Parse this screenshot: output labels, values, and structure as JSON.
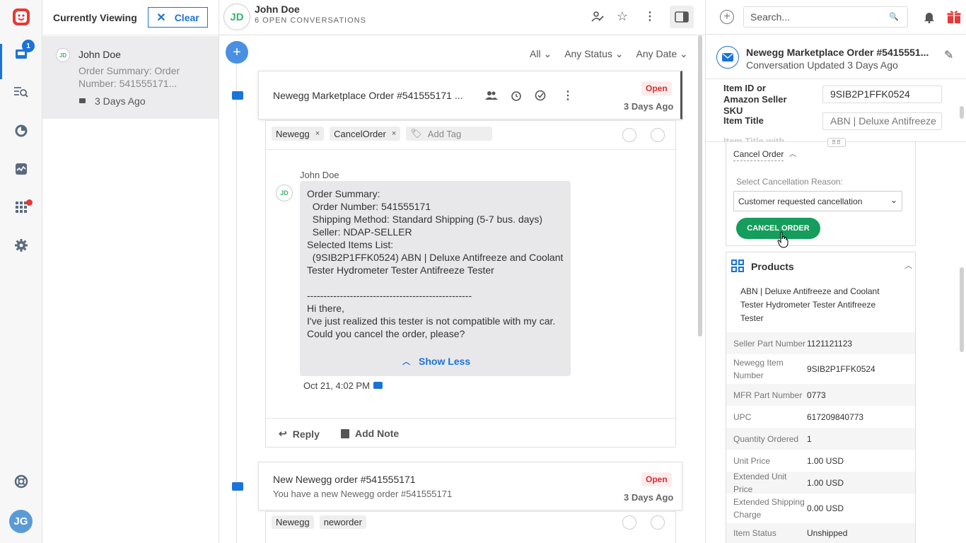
{
  "rail": {
    "inbox_badge": "1",
    "avatar_initials": "JG"
  },
  "list": {
    "header": "Currently Viewing",
    "clear_label": "Clear",
    "item": {
      "initials": "JD",
      "name": "John Doe",
      "preview": "Order Summary:  Order Number: 541555171...",
      "time": "3 Days Ago"
    }
  },
  "conversation": {
    "initials": "JD",
    "name": "John Doe",
    "sub": "6 OPEN CONVERSATIONS",
    "filters": [
      "All",
      "Any Status",
      "Any Date"
    ],
    "card1": {
      "subject": "Newegg Marketplace Order #541555171 ...",
      "status": "Open",
      "time": "3 Days Ago",
      "tags": [
        "Newegg",
        "CancelOrder"
      ],
      "add_tag": "Add Tag",
      "author": "John Doe",
      "author_initials": "JD",
      "body": "Order Summary:\n  Order Number: 541555171\n  Shipping Method: Standard Shipping (5-7 bus. days)\n  Seller: NDAP-SELLER\nSelected Items List:\n  (9SIB2P1FFK0524) ABN | Deluxe Antifreeze and Coolant Tester Hydrometer Tester Antifreeze Tester\n\n--------------------------------------------------\nHi there,\nI've just realized this tester is not compatible with my car. Could you cancel the order, please?",
      "show_less": "Show Less",
      "timestamp": "Oct 21, 4:02 PM",
      "reply": "Reply",
      "add_note": "Add Note"
    },
    "card2": {
      "subject": "New Newegg order #541555171",
      "preview": "You have a new Newegg order #541555171",
      "status": "Open",
      "time": "3 Days Ago",
      "tags": [
        "Newegg",
        "neworder"
      ]
    }
  },
  "right": {
    "search_placeholder": "Search...",
    "title": "Newegg Marketplace Order #5415551...",
    "subtitle": "Conversation Updated 3 Days Ago",
    "fields": [
      {
        "label": "Item ID or Amazon Seller SKU",
        "value": "9SIB2P1FFK0524"
      },
      {
        "label": "Item Title",
        "value": "ABN | Deluxe Antifreeze"
      },
      {
        "label": "Item Title with",
        "value": ""
      }
    ],
    "cancel_section": "Cancel Order",
    "reason_label": "Select Cancellation Reason:",
    "reason_value": "Customer requested cancellation",
    "cancel_button": "CANCEL ORDER",
    "products_title": "Products",
    "product_name": "ABN | Deluxe Antifreeze and Coolant Tester Hydrometer Tester Antifreeze Tester",
    "product_rows": [
      {
        "k": "Seller Part Number",
        "v": "1121121123"
      },
      {
        "k": "Newegg Item Number",
        "v": "9SIB2P1FFK0524"
      },
      {
        "k": "MFR Part Number",
        "v": "0773"
      },
      {
        "k": "UPC",
        "v": "617209840773"
      },
      {
        "k": "Quantity Ordered",
        "v": "1"
      },
      {
        "k": "Unit Price",
        "v": "1.00 USD"
      },
      {
        "k": "Extended Unit Price",
        "v": "1.00 USD"
      },
      {
        "k": "Extended Shipping Charge",
        "v": "0.00 USD"
      },
      {
        "k": "Item Status",
        "v": "Unshipped"
      }
    ],
    "colors": {
      "accent": "#1a73d9",
      "green": "#149d5c",
      "open_red": "#d32f2f"
    }
  }
}
